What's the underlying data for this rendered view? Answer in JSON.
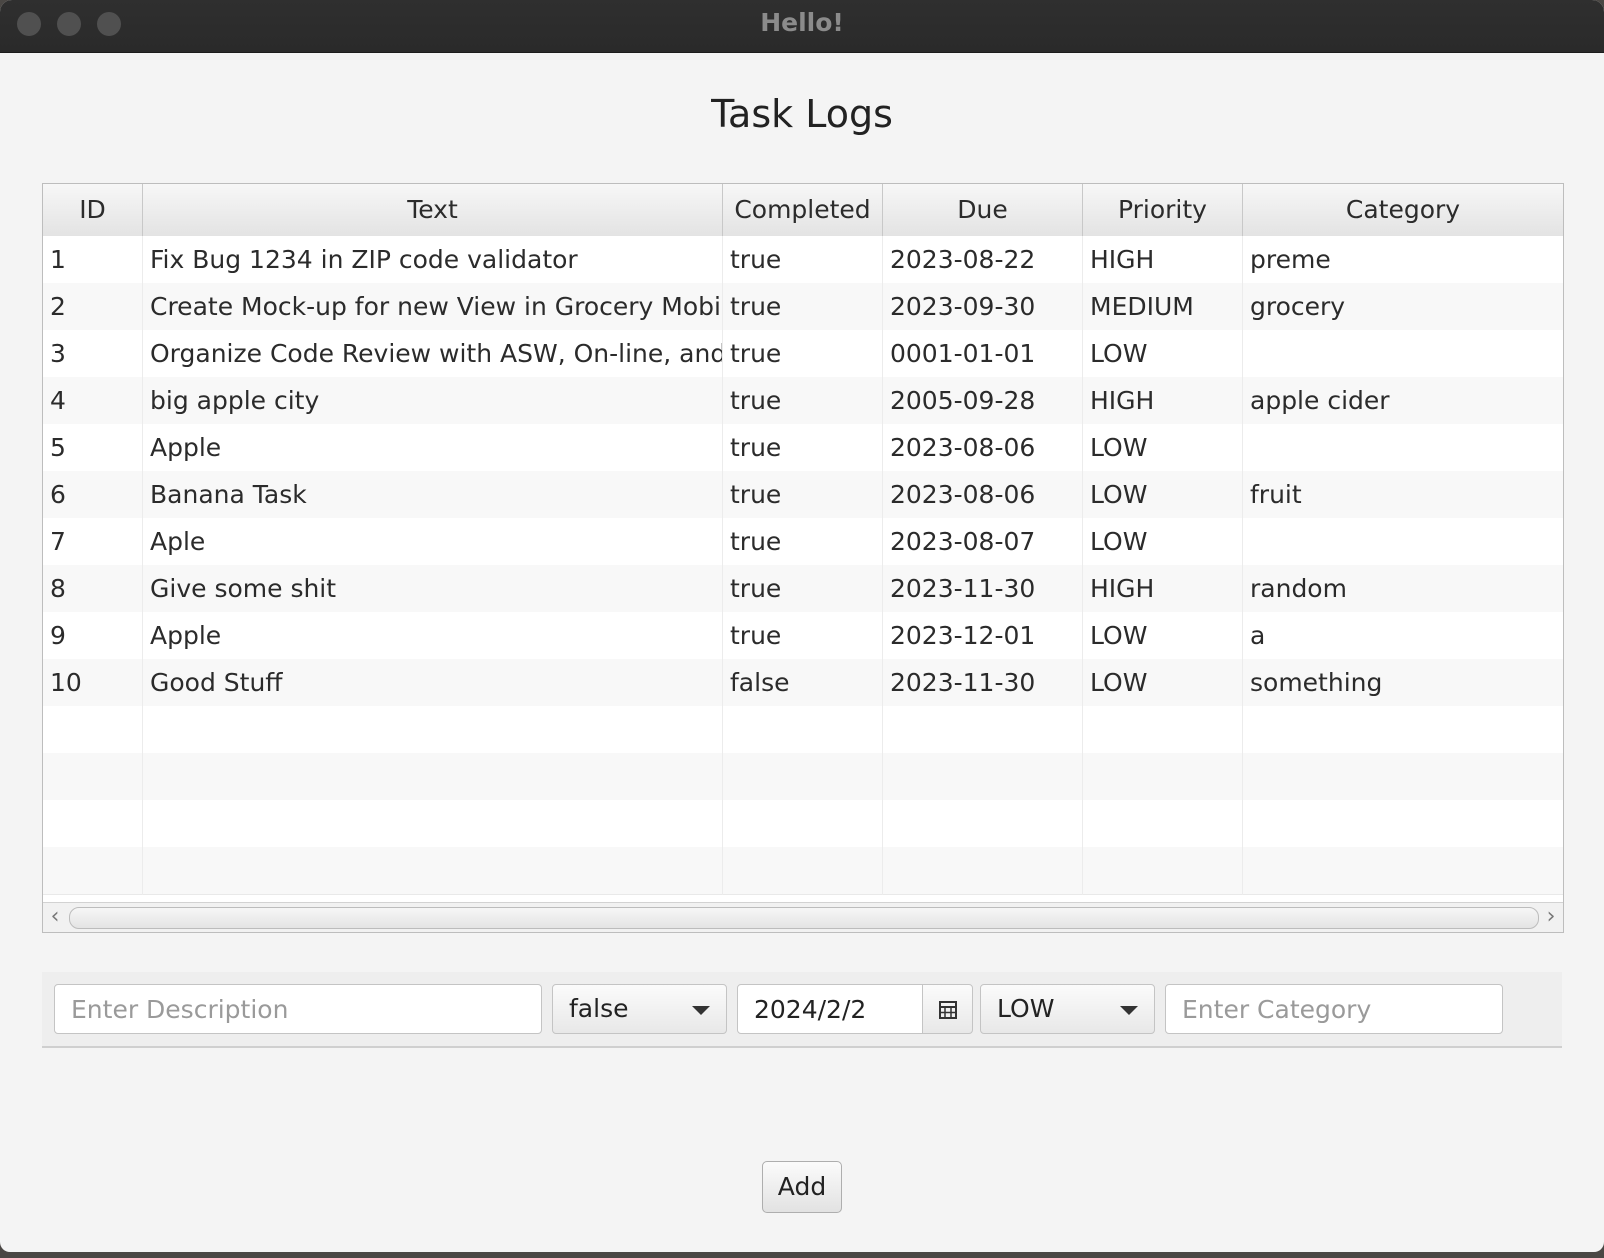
{
  "window": {
    "title": "Hello!"
  },
  "page": {
    "title": "Task Logs"
  },
  "table": {
    "columns": [
      "ID",
      "Text",
      "Completed",
      "Due",
      "Priority",
      "Category"
    ],
    "rows": [
      [
        "1",
        "Fix Bug 1234 in ZIP code validator",
        "true",
        "2023-08-22",
        "HIGH",
        "preme"
      ],
      [
        "2",
        "Create Mock-up for new View in Grocery Mobile A...",
        "true",
        "2023-09-30",
        "MEDIUM",
        "grocery"
      ],
      [
        "3",
        "Organize Code Review with ASW, On-line, and Ma...",
        "true",
        "0001-01-01",
        "LOW",
        ""
      ],
      [
        "4",
        "big apple city",
        "true",
        "2005-09-28",
        "HIGH",
        "apple cider"
      ],
      [
        "5",
        "Apple",
        "true",
        "2023-08-06",
        "LOW",
        ""
      ],
      [
        "6",
        "Banana Task",
        "true",
        "2023-08-06",
        "LOW",
        "fruit"
      ],
      [
        "7",
        "Aple",
        "true",
        "2023-08-07",
        "LOW",
        ""
      ],
      [
        "8",
        "Give some shit",
        "true",
        "2023-11-30",
        "HIGH",
        "random"
      ],
      [
        "9",
        "Apple",
        "true",
        "2023-12-01",
        "LOW",
        "a"
      ],
      [
        "10",
        "Good Stuff",
        "false",
        "2023-11-30",
        "LOW",
        "something"
      ]
    ],
    "empty_rows": 4
  },
  "form": {
    "description_placeholder": "Enter Description",
    "completed_value": "false",
    "due_value": "2024/2/2",
    "priority_value": "LOW",
    "category_placeholder": "Enter Category",
    "add_label": "Add"
  },
  "icons": {
    "window_controls": [
      "close-dot",
      "minimize-dot",
      "zoom-dot"
    ],
    "date_picker": "calendar-icon",
    "dropdown": "chevron-down-icon",
    "scroll_left": "chevron-left-icon",
    "scroll_right": "chevron-right-icon"
  }
}
